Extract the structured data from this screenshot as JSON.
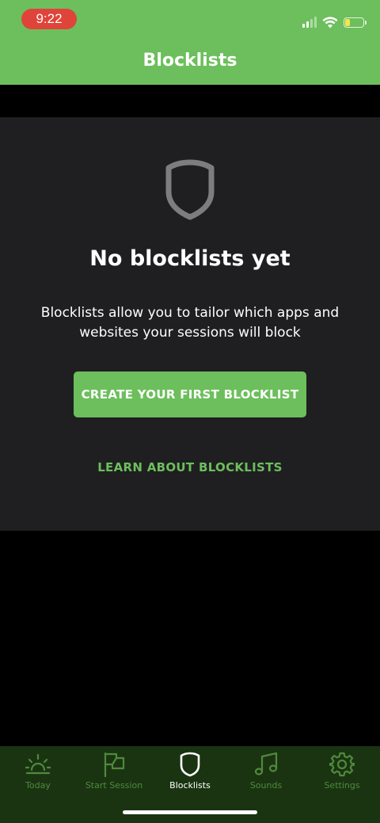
{
  "status_bar": {
    "time": "9:22"
  },
  "header": {
    "title": "Blocklists"
  },
  "empty_state": {
    "icon": "shield-icon",
    "title": "No blocklists yet",
    "description": "Blocklists allow you to tailor which apps and websites your sessions will block",
    "primary_button": "CREATE YOUR FIRST BLOCKLIST",
    "secondary_link": "LEARN ABOUT BLOCKLISTS"
  },
  "tabs": [
    {
      "label": "Today",
      "icon": "sunrise-icon",
      "active": false
    },
    {
      "label": "Start Session",
      "icon": "flag-icon",
      "active": false
    },
    {
      "label": "Blocklists",
      "icon": "shield-icon",
      "active": true
    },
    {
      "label": "Sounds",
      "icon": "music-note-icon",
      "active": false
    },
    {
      "label": "Settings",
      "icon": "gear-icon",
      "active": false
    }
  ],
  "colors": {
    "accent": "#6cbf5c",
    "tabbar_bg": "#1a3412",
    "tab_inactive": "#4f8a3c",
    "card_bg": "#1f1f21",
    "recording_pill": "#e0433a"
  }
}
